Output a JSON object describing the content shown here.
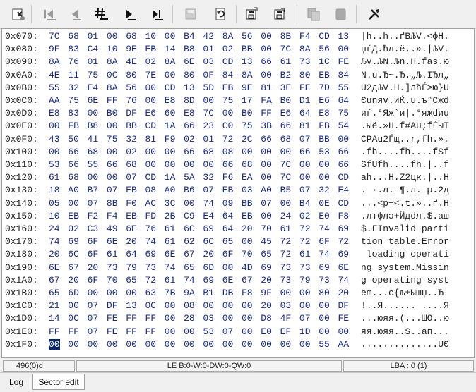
{
  "toolbar": {
    "buttons": [
      {
        "name": "boot-sector-icon",
        "enabled": true
      },
      {
        "name": "first-sector-icon",
        "enabled": false
      },
      {
        "name": "previous-sector-icon",
        "enabled": false
      },
      {
        "name": "go-to-sector-icon",
        "enabled": true
      },
      {
        "name": "next-sector-icon",
        "enabled": true
      },
      {
        "name": "last-sector-icon",
        "enabled": true
      },
      {
        "name": "save-icon",
        "enabled": false
      },
      {
        "name": "refresh-icon",
        "enabled": true
      },
      {
        "name": "save-sector-to-file-icon",
        "enabled": true
      },
      {
        "name": "load-sector-from-file-icon",
        "enabled": true
      },
      {
        "name": "copy-icon",
        "enabled": false
      },
      {
        "name": "paste-icon",
        "enabled": false
      },
      {
        "name": "tools-icon",
        "enabled": true
      }
    ]
  },
  "hex": {
    "rows": [
      {
        "addr": "0x070:",
        "bytes": [
          "7C",
          "68",
          "01",
          "00",
          "68",
          "10",
          "00",
          "B4",
          "42",
          "8A",
          "56",
          "00",
          "8B",
          "F4",
          "CD",
          "13"
        ],
        "ascii": "|h..h..ґBЉV.<фН."
      },
      {
        "addr": "0x080:",
        "bytes": [
          "9F",
          "83",
          "C4",
          "10",
          "9E",
          "EB",
          "14",
          "B8",
          "01",
          "02",
          "BB",
          "00",
          "7C",
          "8A",
          "56",
          "00"
        ],
        "ascii": "џѓД.ћл.ё..».|ЉV."
      },
      {
        "addr": "0x090:",
        "bytes": [
          "8A",
          "76",
          "01",
          "8A",
          "4E",
          "02",
          "8A",
          "6E",
          "03",
          "CD",
          "13",
          "66",
          "61",
          "73",
          "1C",
          "FE"
        ],
        "ascii": "Љv.ЉN.Љn.Н.fas.ю"
      },
      {
        "addr": "0x0A0:",
        "bytes": [
          "4E",
          "11",
          "75",
          "0C",
          "80",
          "7E",
          "00",
          "80",
          "0F",
          "84",
          "8A",
          "00",
          "B2",
          "80",
          "EB",
          "84"
        ],
        "ascii": "N.u.Ђ~.Ђ.„Љ.ІЂл„"
      },
      {
        "addr": "0x0B0:",
        "bytes": [
          "55",
          "32",
          "E4",
          "8A",
          "56",
          "00",
          "CD",
          "13",
          "5D",
          "EB",
          "9E",
          "81",
          "3E",
          "FE",
          "7D",
          "55"
        ],
        "ascii": "U2дЉV.Н.]лћЃ>ю}U"
      },
      {
        "addr": "0x0C0:",
        "bytes": [
          "AA",
          "75",
          "6E",
          "FF",
          "76",
          "00",
          "E8",
          "8D",
          "00",
          "75",
          "17",
          "FA",
          "B0",
          "D1",
          "E6",
          "64"
        ],
        "ascii": "Єunяv.иЌ.u.ъ°Сжd"
      },
      {
        "addr": "0x0D0:",
        "bytes": [
          "E8",
          "83",
          "00",
          "B0",
          "DF",
          "E6",
          "60",
          "E8",
          "7C",
          "00",
          "B0",
          "FF",
          "E6",
          "64",
          "E8",
          "75"
        ],
        "ascii": "иѓ.°Яж`и|.°яжdиu"
      },
      {
        "addr": "0x0E0:",
        "bytes": [
          "00",
          "FB",
          "B8",
          "00",
          "BB",
          "CD",
          "1A",
          "66",
          "23",
          "C0",
          "75",
          "3B",
          "66",
          "81",
          "FB",
          "54"
        ],
        "ascii": ".ыё.»Н.f#Аu;fЃыT"
      },
      {
        "addr": "0x0F0:",
        "bytes": [
          "43",
          "50",
          "41",
          "75",
          "32",
          "81",
          "F9",
          "02",
          "01",
          "72",
          "2C",
          "66",
          "68",
          "07",
          "BB",
          "00"
        ],
        "ascii": "CPAu2Ѓщ..r,fh.»."
      },
      {
        "addr": "0x100:",
        "bytes": [
          "00",
          "66",
          "68",
          "00",
          "02",
          "00",
          "00",
          "66",
          "68",
          "08",
          "00",
          "00",
          "00",
          "66",
          "53",
          "66"
        ],
        "ascii": ".fh....fh....fSf"
      },
      {
        "addr": "0x110:",
        "bytes": [
          "53",
          "66",
          "55",
          "66",
          "68",
          "00",
          "00",
          "00",
          "00",
          "66",
          "68",
          "00",
          "7C",
          "00",
          "00",
          "66"
        ],
        "ascii": "SfUfh....fh.|..f"
      },
      {
        "addr": "0x120:",
        "bytes": [
          "61",
          "68",
          "00",
          "00",
          "07",
          "CD",
          "1A",
          "5A",
          "32",
          "F6",
          "EA",
          "00",
          "7C",
          "00",
          "00",
          "CD"
        ],
        "ascii": "ah...Н.Z2цк.|..Н"
      },
      {
        "addr": "0x130:",
        "bytes": [
          "18",
          "A0",
          "B7",
          "07",
          "EB",
          "08",
          "A0",
          "B6",
          "07",
          "EB",
          "03",
          "A0",
          "B5",
          "07",
          "32",
          "E4"
        ],
        "ascii": ". ·.л. ¶.л. µ.2д"
      },
      {
        "addr": "0x140:",
        "bytes": [
          "05",
          "00",
          "07",
          "8B",
          "F0",
          "AC",
          "3C",
          "00",
          "74",
          "09",
          "BB",
          "07",
          "00",
          "B4",
          "0E",
          "CD"
        ],
        "ascii": "...<р¬<.t.»..ґ.Н"
      },
      {
        "addr": "0x150:",
        "bytes": [
          "10",
          "EB",
          "F2",
          "F4",
          "EB",
          "FD",
          "2B",
          "C9",
          "E4",
          "64",
          "EB",
          "00",
          "24",
          "02",
          "E0",
          "F8"
        ],
        "ascii": ".лтфлэ+Йдdл.$.аш"
      },
      {
        "addr": "0x160:",
        "bytes": [
          "24",
          "02",
          "C3",
          "49",
          "6E",
          "76",
          "61",
          "6C",
          "69",
          "64",
          "20",
          "70",
          "61",
          "72",
          "74",
          "69"
        ],
        "ascii": "$.ГInvalid parti"
      },
      {
        "addr": "0x170:",
        "bytes": [
          "74",
          "69",
          "6F",
          "6E",
          "20",
          "74",
          "61",
          "62",
          "6C",
          "65",
          "00",
          "45",
          "72",
          "72",
          "6F",
          "72"
        ],
        "ascii": "tion table.Error"
      },
      {
        "addr": "0x180:",
        "bytes": [
          "20",
          "6C",
          "6F",
          "61",
          "64",
          "69",
          "6E",
          "67",
          "20",
          "6F",
          "70",
          "65",
          "72",
          "61",
          "74",
          "69"
        ],
        "ascii": " loading operati"
      },
      {
        "addr": "0x190:",
        "bytes": [
          "6E",
          "67",
          "20",
          "73",
          "79",
          "73",
          "74",
          "65",
          "6D",
          "00",
          "4D",
          "69",
          "73",
          "73",
          "69",
          "6E"
        ],
        "ascii": "ng system.Missin"
      },
      {
        "addr": "0x1A0:",
        "bytes": [
          "67",
          "20",
          "6F",
          "70",
          "65",
          "72",
          "61",
          "74",
          "69",
          "6E",
          "67",
          "20",
          "73",
          "79",
          "73",
          "74"
        ],
        "ascii": "g operating syst"
      },
      {
        "addr": "0x1B0:",
        "bytes": [
          "65",
          "6D",
          "00",
          "00",
          "00",
          "63",
          "7B",
          "9A",
          "B1",
          "DB",
          "F8",
          "9F",
          "00",
          "00",
          "80",
          "20"
        ],
        "ascii": "em...c{љ±Ышџ..Ђ "
      },
      {
        "addr": "0x1C0:",
        "bytes": [
          "21",
          "00",
          "07",
          "DF",
          "13",
          "0C",
          "00",
          "08",
          "00",
          "00",
          "00",
          "20",
          "03",
          "00",
          "00",
          "DF"
        ],
        "ascii": "!..Я...... ....Я"
      },
      {
        "addr": "0x1D0:",
        "bytes": [
          "14",
          "0C",
          "07",
          "FE",
          "FF",
          "FF",
          "00",
          "28",
          "03",
          "00",
          "00",
          "D8",
          "4F",
          "07",
          "00",
          "FE"
        ],
        "ascii": "...юяя.(...ШО..ю"
      },
      {
        "addr": "0x1E0:",
        "bytes": [
          "FF",
          "FF",
          "07",
          "FE",
          "FF",
          "FF",
          "00",
          "00",
          "53",
          "07",
          "00",
          "E0",
          "EF",
          "1D",
          "00",
          "00"
        ],
        "ascii": "яя.юяя..S..ап..."
      },
      {
        "addr": "0x1F0:",
        "bytes": [
          "00",
          "00",
          "00",
          "00",
          "00",
          "00",
          "00",
          "00",
          "00",
          "00",
          "00",
          "00",
          "00",
          "00",
          "55",
          "AA"
        ],
        "ascii": "..............UЄ"
      }
    ],
    "cursor_row": 24,
    "cursor_col": 0
  },
  "status": {
    "position": "496(0)d",
    "values": "LE B:0-W:0-DW:0-QW:0",
    "lba": "LBA : 0 (1)"
  },
  "tabs": [
    {
      "label": "Log",
      "active": false
    },
    {
      "label": "Sector edit",
      "active": true
    }
  ]
}
